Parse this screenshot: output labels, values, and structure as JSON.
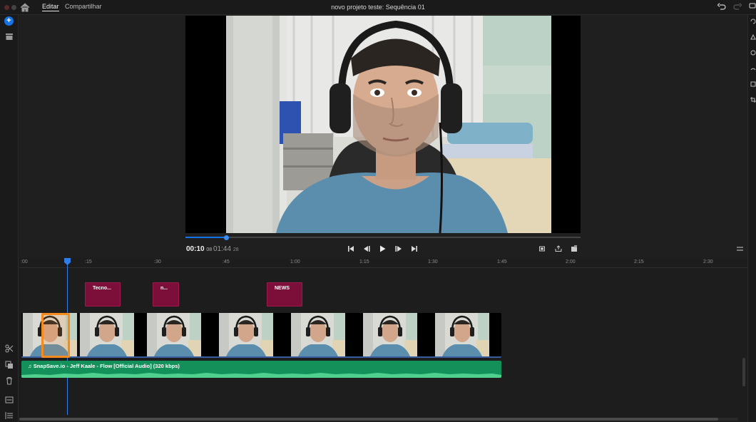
{
  "header": {
    "tabs": [
      {
        "label": "Editar",
        "active": true
      },
      {
        "label": "Compartilhar",
        "active": false
      }
    ],
    "title": "novo projeto teste: Sequência 01"
  },
  "player": {
    "current_time": "00:10",
    "current_frames": "08",
    "total_time": "01:44",
    "total_frames": "28",
    "playback_progress": 0.103
  },
  "timeline": {
    "ruler_labels": [
      ":00",
      ":15",
      ":30",
      ":45",
      "1:00",
      "1:15",
      "1:30",
      "1:45",
      "2:00",
      "2:15",
      "2:30"
    ],
    "title_clips": [
      {
        "label": "Tecno..."
      },
      {
        "label": "n..."
      },
      {
        "label": "NEWS"
      }
    ],
    "audio_clip_label": "SnapSave.io - Jeff Kaale - Flow [Official Audio] (320 kbps)"
  },
  "colors": {
    "accent": "#1473e6",
    "title_clip": "#7c0e3a",
    "audio_clip": "#14915b",
    "selection": "#f58a1f",
    "playhead": "#2f7de8"
  }
}
